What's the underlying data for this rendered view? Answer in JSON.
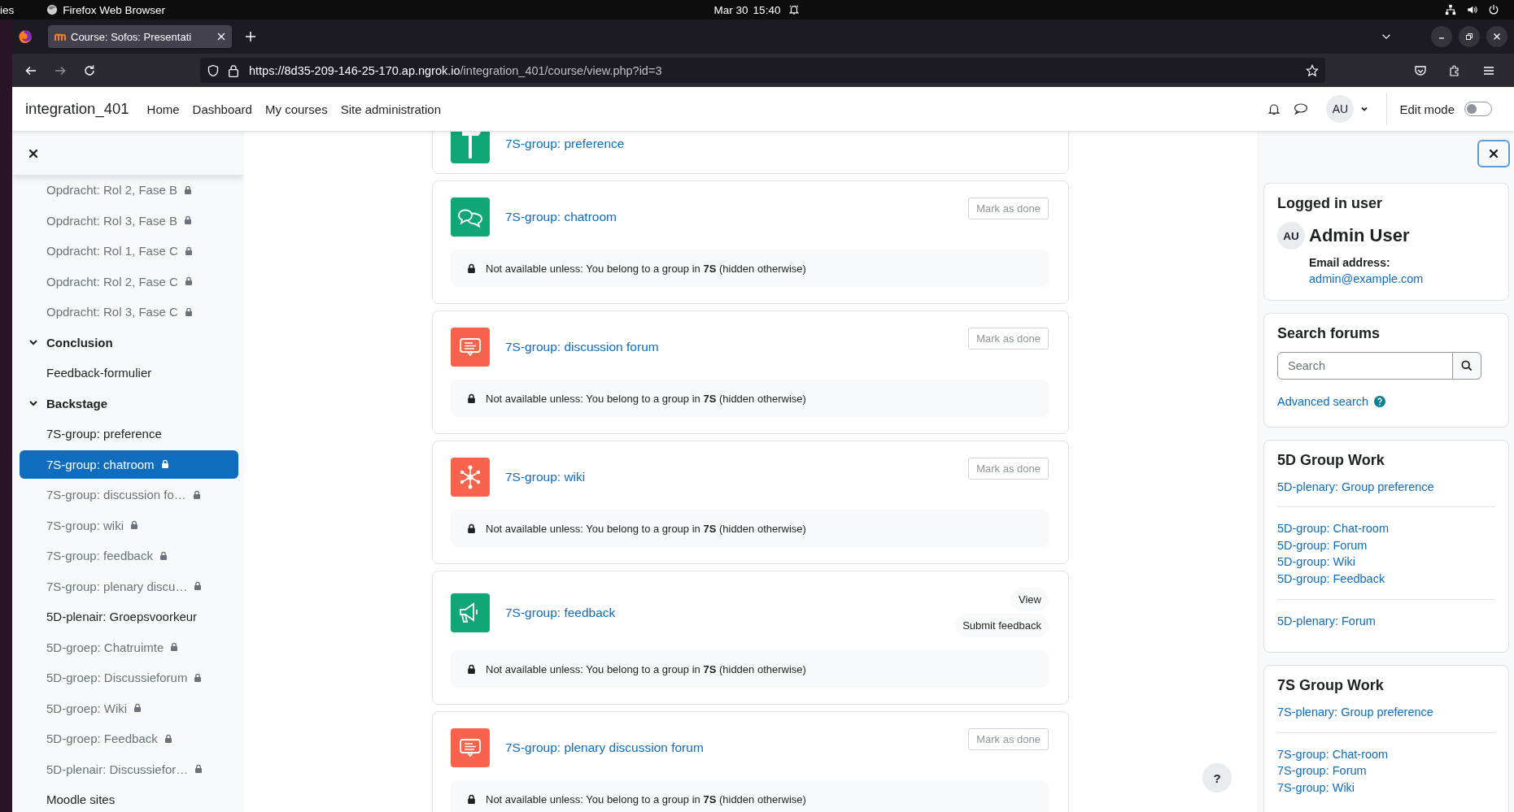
{
  "os_bar": {
    "activities": "ies",
    "app": "Firefox Web Browser",
    "date": "Mar 30",
    "time": "15:40"
  },
  "browser": {
    "tab_title": "Course: Sofos: Presentati",
    "url_host": "https://8d35-209-146-25-170.ap.ngrok.io",
    "url_path": "/integration_401/course/view.php?id=3"
  },
  "navbar": {
    "site_name": "integration_401",
    "links": [
      "Home",
      "Dashboard",
      "My courses",
      "Site administration"
    ],
    "avatar": "AU",
    "edit_mode": {
      "label": "Edit mode",
      "on": false
    }
  },
  "course_index": {
    "items": [
      {
        "kind": "activity",
        "label": "Opdracht: Rol 2, Fase B",
        "locked": true,
        "selected": false
      },
      {
        "kind": "activity",
        "label": "Opdracht: Rol 3, Fase B",
        "locked": true,
        "selected": false
      },
      {
        "kind": "activity",
        "label": "Opdracht: Rol 1, Fase C",
        "locked": true,
        "selected": false
      },
      {
        "kind": "activity",
        "label": "Opdracht: Rol 2, Fase C",
        "locked": true,
        "selected": false
      },
      {
        "kind": "activity",
        "label": "Opdracht: Rol 3, Fase C",
        "locked": true,
        "selected": false
      },
      {
        "kind": "section",
        "label": "Conclusion",
        "expanded": true
      },
      {
        "kind": "activity",
        "label": "Feedback-formulier",
        "locked": false,
        "selected": false
      },
      {
        "kind": "section",
        "label": "Backstage",
        "expanded": true
      },
      {
        "kind": "activity",
        "label": "7S-group: preference",
        "locked": false,
        "selected": false
      },
      {
        "kind": "activity",
        "label": "7S-group: chatroom",
        "locked": true,
        "selected": true
      },
      {
        "kind": "activity",
        "label": "7S-group: discussion fo…",
        "locked": true,
        "selected": false
      },
      {
        "kind": "activity",
        "label": "7S-group: wiki",
        "locked": true,
        "selected": false
      },
      {
        "kind": "activity",
        "label": "7S-group: feedback",
        "locked": true,
        "selected": false
      },
      {
        "kind": "activity",
        "label": "7S-group: plenary discu…",
        "locked": true,
        "selected": false
      },
      {
        "kind": "activity",
        "label": "5D-plenair: Groepsvoorkeur",
        "locked": false,
        "selected": false
      },
      {
        "kind": "activity",
        "label": "5D-groep: Chatruimte",
        "locked": true,
        "selected": false
      },
      {
        "kind": "activity",
        "label": "5D-groep: Discussieforum",
        "locked": true,
        "selected": false
      },
      {
        "kind": "activity",
        "label": "5D-groep: Wiki",
        "locked": true,
        "selected": false
      },
      {
        "kind": "activity",
        "label": "5D-groep: Feedback",
        "locked": true,
        "selected": false
      },
      {
        "kind": "activity",
        "label": "5D-plenair: Discussiefor…",
        "locked": true,
        "selected": false
      },
      {
        "kind": "activity",
        "label": "Moodle sites",
        "locked": false,
        "selected": false
      }
    ]
  },
  "activities": [
    {
      "kind": "choice",
      "color": "#11a676",
      "title": "7S-group: preference"
    },
    {
      "kind": "chat",
      "color": "#11a676",
      "title": "7S-group: chatroom",
      "actions": [
        {
          "kind": "outline",
          "label": "Mark as done"
        }
      ],
      "restriction": "Not available unless: You belong to a group in **7S** (hidden otherwise)"
    },
    {
      "kind": "forum",
      "color": "#f7634d",
      "title": "7S-group: discussion forum",
      "actions": [
        {
          "kind": "outline",
          "label": "Mark as done"
        }
      ],
      "restriction": "Not available unless: You belong to a group in **7S** (hidden otherwise)"
    },
    {
      "kind": "wiki",
      "color": "#f7634d",
      "title": "7S-group: wiki",
      "actions": [
        {
          "kind": "outline",
          "label": "Mark as done"
        }
      ],
      "restriction": "Not available unless: You belong to a group in **7S** (hidden otherwise)"
    },
    {
      "kind": "feedback",
      "color": "#11a676",
      "title": "7S-group: feedback",
      "actions": [
        {
          "kind": "pill",
          "label": "View"
        },
        {
          "kind": "pill",
          "label": "Submit feedback"
        }
      ],
      "restriction": "Not available unless: You belong to a group in **7S** (hidden otherwise)"
    },
    {
      "kind": "forum",
      "color": "#f7634d",
      "title": "7S-group: plenary discussion forum",
      "actions": [
        {
          "kind": "outline",
          "label": "Mark as done"
        }
      ],
      "restriction": "Not available unless: You belong to a group in **7S** (hidden otherwise)"
    }
  ],
  "help_button": "?",
  "blocks": [
    {
      "kind": "user",
      "title": "Logged in user",
      "avatar": "AU",
      "name": "Admin User",
      "email_label": "Email address:",
      "email": "admin@example.com"
    },
    {
      "kind": "search",
      "title": "Search forums",
      "placeholder": "Search",
      "advanced": "Advanced search"
    },
    {
      "kind": "links",
      "title": "5D Group Work",
      "groups": [
        [
          "5D-plenary: Group preference"
        ],
        [
          "5D-group: Chat-room",
          "5D-group: Forum",
          "5D-group: Wiki",
          "5D-group: Feedback"
        ],
        [
          "5D-plenary: Forum"
        ]
      ]
    },
    {
      "kind": "links",
      "title": "7S Group Work",
      "groups": [
        [
          "7S-plenary: Group preference"
        ],
        [
          "7S-group: Chat-room",
          "7S-group: Forum",
          "7S-group: Wiki"
        ]
      ]
    }
  ]
}
